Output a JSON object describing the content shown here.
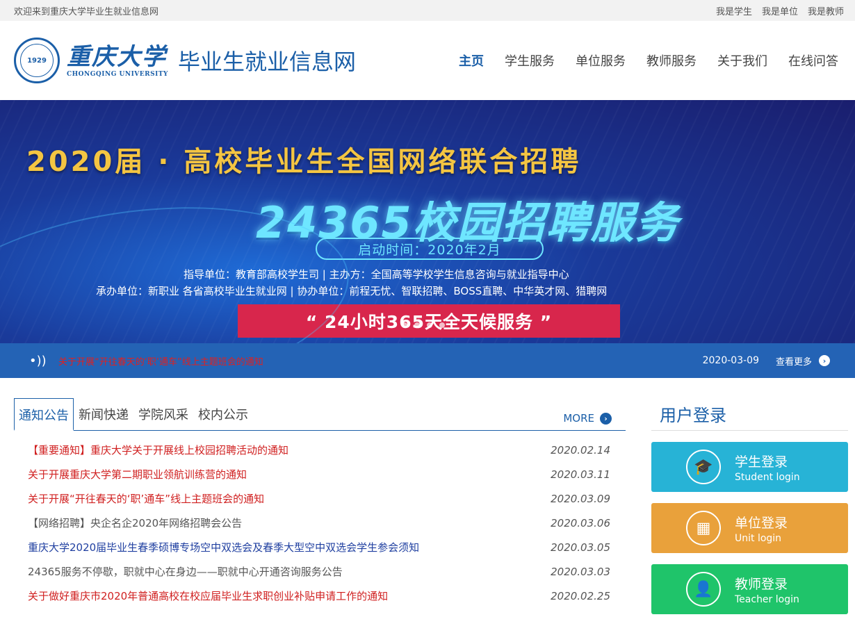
{
  "topbar": {
    "welcome": "欢迎来到重庆大学毕业生就业信息网",
    "links": [
      "我是学生",
      "我是单位",
      "我是教师"
    ]
  },
  "header": {
    "seal_year": "1929",
    "university_cn": "重庆大学",
    "university_en": "CHONGQING UNIVERSITY",
    "site_name": "毕业生就业信息网",
    "nav": [
      "主页",
      "学生服务",
      "单位服务",
      "教师服务",
      "关于我们",
      "在线问答"
    ]
  },
  "banner": {
    "title": "2020届 · 高校毕业生全国网络联合招聘",
    "subtitle": "24365校园招聘服务",
    "start": "启动时间：2020年2月",
    "line1": "指导单位：教育部高校学生司  |  主办方：全国高等学校学生信息咨询与就业指导中心",
    "line2": "承办单位：新职业 各省高校毕业生就业网  |  协办单位：前程无忧、智联招聘、BOSS直聘、中华英才网、猎聘网",
    "service": "“ 24小时365天全天候服务 ”"
  },
  "notice": {
    "message": "关于开展“开往春天的‘职’通车”线上主题班会的通知",
    "date": "2020-03-09",
    "more": "查看更多"
  },
  "news": {
    "tabs": [
      "通知公告",
      "新闻快递",
      "学院风采",
      "校内公示"
    ],
    "more": "MORE",
    "items": [
      {
        "title": "【重要通知】重庆大学关于开展线上校园招聘活动的通知",
        "date": "2020.02.14"
      },
      {
        "title": "关于开展重庆大学第二期职业领航训练营的通知",
        "date": "2020.03.11"
      },
      {
        "title": "关于开展“开往春天的‘职’通车”线上主题班会的通知",
        "date": "2020.03.09"
      },
      {
        "title": "【网络招聘】央企名企2020年网络招聘会公告",
        "date": "2020.03.06"
      },
      {
        "title": "重庆大学2020届毕业生春季硕博专场空中双选会及春季大型空中双选会学生参会须知",
        "date": "2020.03.05"
      },
      {
        "title": "24365服务不停歇，职就中心在身边——职就中心开通咨询服务公告",
        "date": "2020.03.03"
      },
      {
        "title": "关于做好重庆市2020年普通高校在校应届毕业生求职创业补贴申请工作的通知",
        "date": "2020.02.25"
      }
    ]
  },
  "login": {
    "title": "用户登录",
    "student": {
      "cn": "学生登录",
      "en": "Student login",
      "color": "#27b3d6"
    },
    "unit": {
      "cn": "单位登录",
      "en": "Unit login",
      "color": "#e9a13b"
    },
    "teacher": {
      "cn": "教师登录",
      "en": "Teacher login",
      "color": "#1fc46a"
    }
  }
}
